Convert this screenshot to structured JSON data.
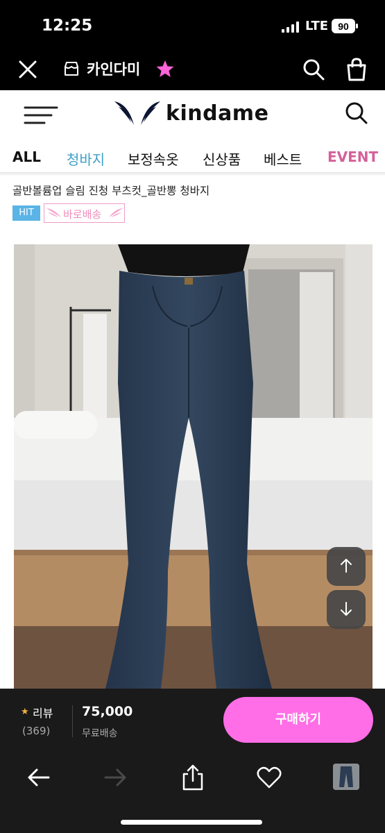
{
  "status": {
    "time": "12:25",
    "network": "LTE",
    "battery": "90"
  },
  "app_header": {
    "store_name": "카인다미",
    "icons": [
      "close-icon",
      "store-icon",
      "star-icon",
      "search-icon",
      "bag-icon"
    ],
    "star_color": "#ff63d9"
  },
  "site": {
    "brand": "kindame",
    "icons": [
      "menu-icon",
      "logo-wing-icon",
      "search-icon"
    ]
  },
  "tabs": [
    "ALL",
    "청바지",
    "보정속옷",
    "신상품",
    "베스트",
    "EVENT"
  ],
  "tab_colors": {
    "active": "#3ea0c6",
    "event": "#d4619a"
  },
  "product": {
    "title": "골반볼륨업 슬림 진청 부츠컷_골반뽕 청바지",
    "badge_hit": "HIT",
    "badge_quick": "바로배송"
  },
  "scroll_buttons": [
    "arrow-up-icon",
    "arrow-down-icon"
  ],
  "buy_bar": {
    "review_label": "리뷰",
    "review_count": "(369)",
    "price": "75,000",
    "shipping": "무료배송",
    "buy_label": "구매하기",
    "buy_color": "#ff6ee6"
  },
  "nav": [
    "back-arrow-icon",
    "forward-arrow-icon",
    "share-icon",
    "heart-icon",
    "product-thumbnail"
  ]
}
